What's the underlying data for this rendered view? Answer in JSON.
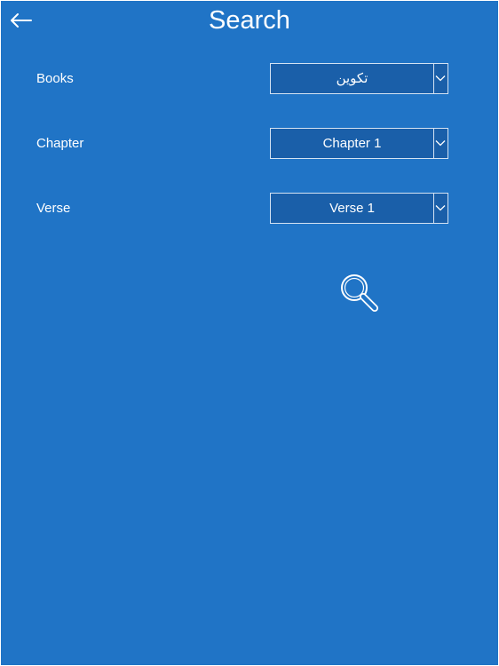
{
  "header": {
    "title": "Search",
    "back_icon": "arrow-left-icon"
  },
  "form": {
    "books": {
      "label": "Books",
      "value": "تکوین"
    },
    "chapter": {
      "label": "Chapter",
      "value": "Chapter 1"
    },
    "verse": {
      "label": "Verse",
      "value": "Verse 1"
    },
    "dropdown_icon": "chevron-down-icon"
  },
  "search": {
    "icon": "search-icon"
  },
  "colors": {
    "background": "#2074c6",
    "field_background": "#1a5fa9",
    "field_border": "#d4e3f3",
    "text": "#ffffff"
  }
}
